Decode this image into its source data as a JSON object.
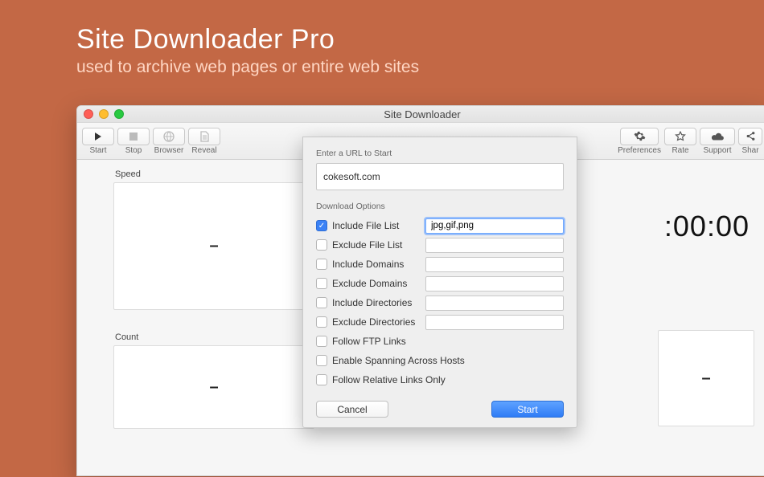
{
  "promo": {
    "title": "Site Downloader Pro",
    "subtitle": "used to archive web pages or entire web sites"
  },
  "window": {
    "title": "Site Downloader"
  },
  "toolbar": {
    "start": "Start",
    "stop": "Stop",
    "browser": "Browser",
    "reveal": "Reveal",
    "preferences": "Preferences",
    "rate": "Rate",
    "support": "Support",
    "share": "Shar"
  },
  "panels": {
    "speed_label": "Speed",
    "speed_value": "–",
    "count_label": "Count",
    "count_value": "–",
    "right_value": "–"
  },
  "timer": ":00:00",
  "dialog": {
    "url_label": "Enter a URL to Start",
    "url_value": "cokesoft.com",
    "options_label": "Download Options",
    "options": [
      {
        "label": "Include File List",
        "checked": true,
        "has_input": true,
        "value": "jpg,gif,png",
        "focused": true
      },
      {
        "label": "Exclude File List",
        "checked": false,
        "has_input": true,
        "value": ""
      },
      {
        "label": "Include Domains",
        "checked": false,
        "has_input": true,
        "value": ""
      },
      {
        "label": "Exclude Domains",
        "checked": false,
        "has_input": true,
        "value": ""
      },
      {
        "label": "Include Directories",
        "checked": false,
        "has_input": true,
        "value": ""
      },
      {
        "label": "Exclude Directories",
        "checked": false,
        "has_input": true,
        "value": ""
      },
      {
        "label": "Follow FTP Links",
        "checked": false,
        "has_input": false
      },
      {
        "label": "Enable Spanning Across Hosts",
        "checked": false,
        "has_input": false
      },
      {
        "label": "Follow Relative Links Only",
        "checked": false,
        "has_input": false
      }
    ],
    "cancel": "Cancel",
    "start": "Start"
  }
}
